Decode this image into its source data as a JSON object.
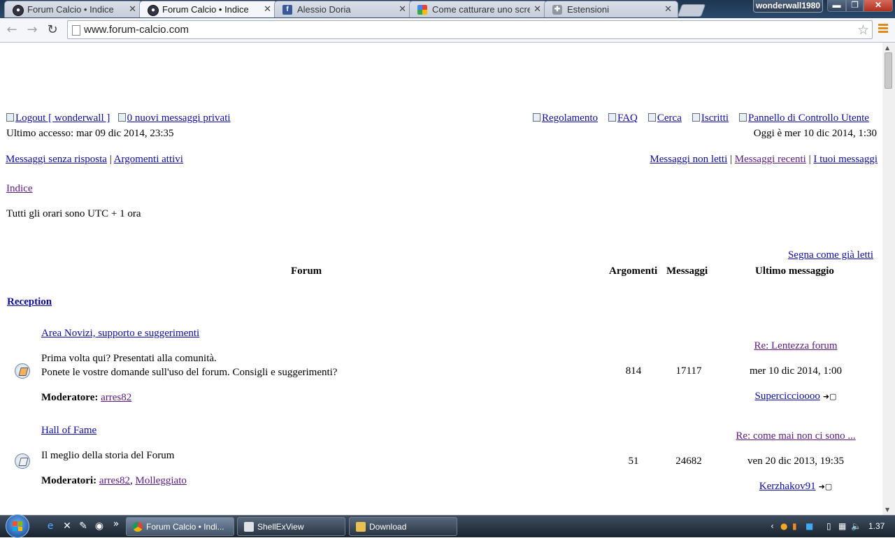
{
  "browser": {
    "tabs": [
      {
        "title": "Forum Calcio • Indice",
        "icon": "globe-icon",
        "active": false
      },
      {
        "title": "Forum Calcio • Indice",
        "icon": "globe-icon",
        "active": true
      },
      {
        "title": "Alessio Doria",
        "icon": "facebook-icon",
        "active": false
      },
      {
        "title": "Come catturare uno scree",
        "icon": "google-icon",
        "active": false
      },
      {
        "title": "Estensioni",
        "icon": "puzzle-icon",
        "active": false
      }
    ],
    "close_glyph": "✕",
    "profile_name": "wonderwall1980",
    "url": "www.forum-calcio.com",
    "accent_colors": {
      "menu": "#e08a1e",
      "close_button": "#c0392b"
    }
  },
  "forum": {
    "top_left": {
      "logout": "Logout [ wonderwall ]",
      "private_messages": "0 nuovi messaggi privati"
    },
    "top_right": {
      "rules": "Regolamento",
      "faq": "FAQ",
      "search": "Cerca",
      "members": "Iscritti",
      "ucp": "Pannello di Controllo Utente"
    },
    "last_visit": "Ultimo accesso: mar 09 dic 2014, 23:35",
    "current_time": "Oggi è mer 10 dic 2014, 1:30",
    "left_links": {
      "unanswered": "Messaggi senza risposta",
      "active": "Argomenti attivi"
    },
    "right_links": {
      "unread": "Messaggi non letti",
      "recent": "Messaggi recenti",
      "own": "I tuoi messaggi"
    },
    "separator": "|",
    "breadcrumb": "Indice",
    "timezone": "Tutti gli orari sono UTC + 1 ora",
    "mark_read": "Segna come già letti",
    "columns": {
      "forum": "Forum",
      "topics": "Argomenti",
      "posts": "Messaggi",
      "last_post": "Ultimo messaggio"
    },
    "category": "Reception",
    "forums": [
      {
        "title": "Area Novizi, supporto e suggerimenti",
        "desc_lines": [
          "Prima volta qui? Presentati alla comunità.",
          "Ponete le vostre domande sull'uso del forum. Consigli e suggerimenti?"
        ],
        "moderator_label": "Moderatore:",
        "moderators": [
          "arres82"
        ],
        "topics": "814",
        "posts": "17117",
        "last_post_title": "Re: Lentezza forum",
        "last_post_date": "mer 10 dic 2014, 1:00",
        "last_post_user": "Superciccioooo",
        "status": "new"
      },
      {
        "title": "Hall of Fame",
        "desc_lines": [
          "Il meglio della storia del Forum"
        ],
        "moderator_label": "Moderatori:",
        "moderators": [
          "arres82",
          "Molleggiato"
        ],
        "mod_sep": ",",
        "topics": "51",
        "posts": "24682",
        "last_post_title": "Re: come mai non ci sono ...",
        "last_post_date": "ven 20 dic 2013, 19:35",
        "last_post_user": "Kerzhakov91",
        "status": "old"
      }
    ]
  },
  "taskbar": {
    "quicklaunch_more": "»",
    "buttons": [
      {
        "label": "Forum Calcio • Indi...",
        "icon": "chrome-icon",
        "active": true
      },
      {
        "label": "ShellExView",
        "icon": "shellexview-icon",
        "active": false
      },
      {
        "label": "Download",
        "icon": "folder-icon",
        "active": false
      }
    ],
    "tray_arrow": "‹",
    "clock": "1.37"
  }
}
